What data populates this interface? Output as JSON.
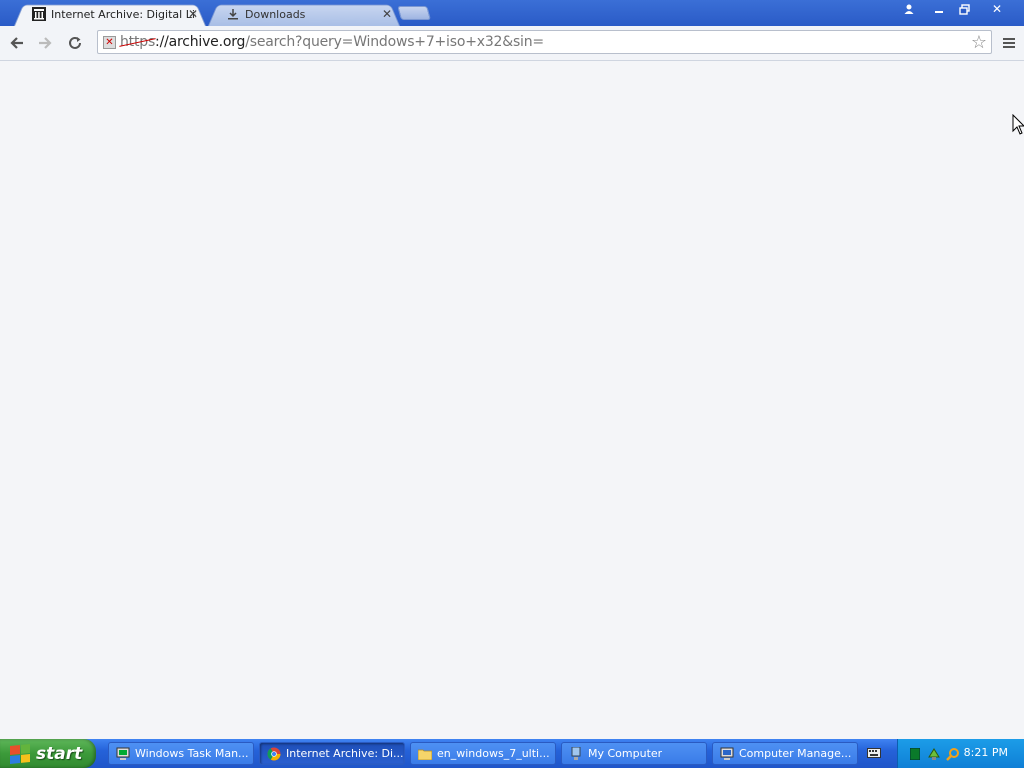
{
  "browser": {
    "tabs": [
      {
        "title": "Internet Archive: Digital Libr",
        "icon": "archive-icon",
        "active": true
      },
      {
        "title": "Downloads",
        "icon": "download-icon",
        "active": false
      }
    ],
    "address_bar": {
      "scheme": "https",
      "host": "://archive.org",
      "path": "/search?query=Windows+7+iso+x32&sin="
    }
  },
  "taskbar": {
    "start_label": "start",
    "tasks": [
      {
        "label": "Windows Task Man...",
        "icon": "task-manager-icon"
      },
      {
        "label": "Internet Archive: Di...",
        "icon": "chrome-icon",
        "active": true
      },
      {
        "label": "en_windows_7_ulti...",
        "icon": "folder-icon"
      },
      {
        "label": "My Computer",
        "icon": "my-computer-icon"
      },
      {
        "label": "Computer Manage...",
        "icon": "computer-management-icon"
      }
    ],
    "clock": "8:21 PM"
  },
  "colors": {
    "taskbar_blue": "#2562d9",
    "start_green": "#3c9a3a",
    "tray_blue": "#0f7fd6",
    "title_blue": "#2a5bc7"
  }
}
